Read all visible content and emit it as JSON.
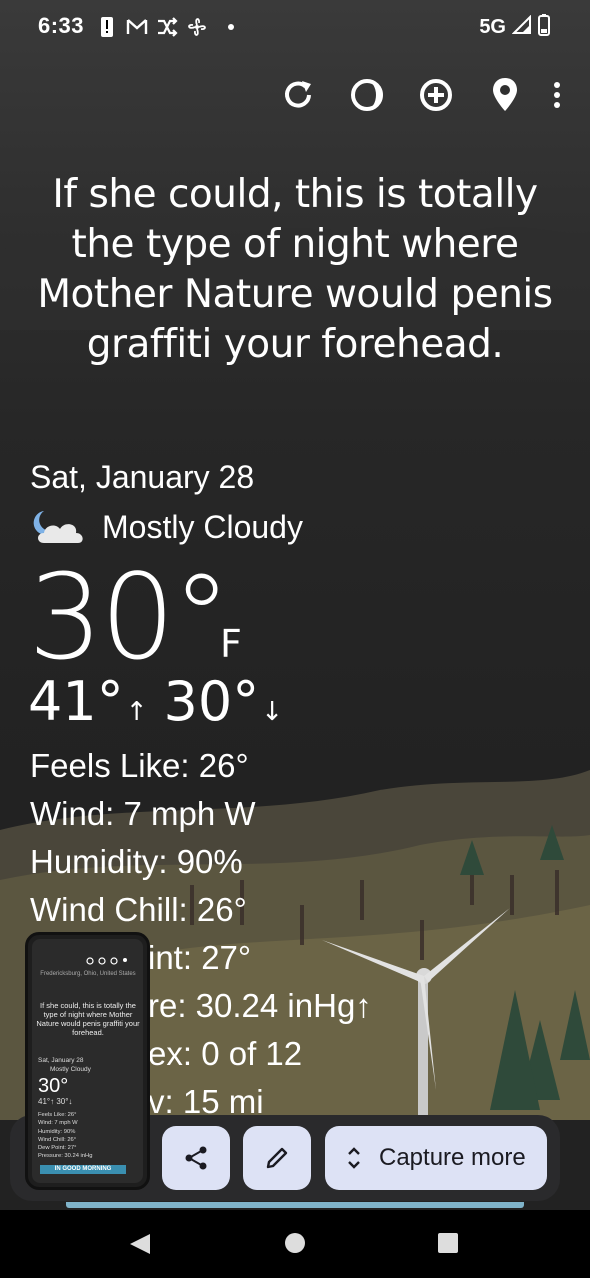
{
  "status_bar": {
    "time": "6:33",
    "network": "5G"
  },
  "toolbar": {
    "refresh_label": "Refresh",
    "theme_label": "Theme",
    "add_label": "Add location",
    "location_label": "Location",
    "more_label": "More options"
  },
  "quote": "If she could, this is totally the type of night where Mother Nature would penis graffiti your forehead.",
  "weather": {
    "date": "Sat, January 28",
    "condition": "Mostly Cloudy",
    "temperature": "30°",
    "unit": "F",
    "high": "41°",
    "low": "30°",
    "details": [
      "Feels Like:  26°",
      "Wind:  7 mph W",
      "Humidity:  90%",
      "Wind Chill:  26°",
      "Dew Point:  27°",
      "Pressure:  30.24 inHg↑",
      "UV Index:  0 of 12",
      "Visibility:  15 mi"
    ],
    "details_visible": [
      "Feels Like:  26°",
      "Wind:  7 mph W",
      "Humidity:  90%",
      "Wind Chill:  26°",
      "int:  27°",
      "re:  30.24 inHg↑",
      "ex:  0 of 12",
      "v:  15 mi"
    ]
  },
  "thumbnail": {
    "location": "Fredericksburg, Ohio, United States",
    "quote": "If she could, this is totally the type of night where Mother Nature would penis graffiti your forehead.",
    "date": "Sat, January 28",
    "condition": "Mostly Cloudy",
    "temperature": "30°",
    "hilo": "41°↑ 30°↓",
    "details": [
      "Feels Like:  26°",
      "Wind:  7 mph W",
      "Humidity:  90%",
      "Wind Chill:  26°",
      "Dew Point:  27°",
      "Pressure:  30.24 inHg"
    ],
    "banner": "IN GOOD MORNING"
  },
  "capture": {
    "share_label": "Share",
    "edit_label": "Edit",
    "more_label": "Capture more"
  },
  "colors": {
    "capture_button_bg": "#dde2f5",
    "capture_bar_bg": "#2a2a2c",
    "banner": "#3a8fb0"
  }
}
